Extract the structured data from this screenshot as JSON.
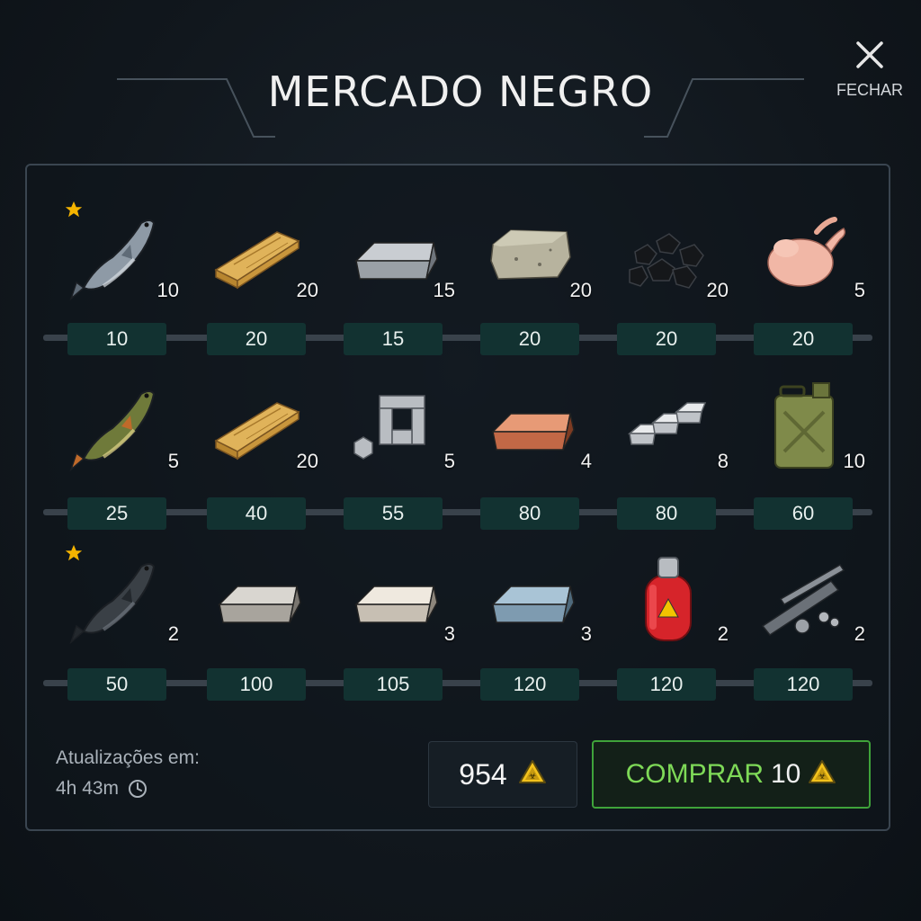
{
  "header": {
    "title": "MERCADO NEGRO",
    "close_label": "FECHAR"
  },
  "colors": {
    "accent_green": "#3fa33a",
    "price_bg": "#123231",
    "star": "#f5b400",
    "panel_border": "#3a4550"
  },
  "rows": [
    [
      {
        "icon": "salmon-fish-icon",
        "qty": "10",
        "price": "10",
        "starred": true
      },
      {
        "icon": "wood-plank-icon",
        "qty": "20",
        "price": "20",
        "starred": false
      },
      {
        "icon": "iron-ingot-icon",
        "qty": "15",
        "price": "15",
        "starred": false
      },
      {
        "icon": "stone-block-icon",
        "qty": "20",
        "price": "20",
        "starred": false
      },
      {
        "icon": "coal-icon",
        "qty": "20",
        "price": "20",
        "starred": false
      },
      {
        "icon": "raw-chicken-icon",
        "qty": "5",
        "price": "20",
        "starred": false
      }
    ],
    [
      {
        "icon": "pike-fish-icon",
        "qty": "5",
        "price": "25",
        "starred": false
      },
      {
        "icon": "wood-plank-icon",
        "qty": "20",
        "price": "40",
        "starred": false
      },
      {
        "icon": "metal-parts-icon",
        "qty": "5",
        "price": "55",
        "starred": false
      },
      {
        "icon": "copper-ingot-icon",
        "qty": "4",
        "price": "80",
        "starred": false
      },
      {
        "icon": "silver-bars-icon",
        "qty": "8",
        "price": "80",
        "starred": false
      },
      {
        "icon": "jerrycan-icon",
        "qty": "10",
        "price": "60",
        "starred": false
      }
    ],
    [
      {
        "icon": "sturgeon-fish-icon",
        "qty": "2",
        "price": "50",
        "starred": true
      },
      {
        "icon": "steel-ingot-icon",
        "qty": "",
        "price": "100",
        "starred": false
      },
      {
        "icon": "titanium-ingot-icon",
        "qty": "3",
        "price": "105",
        "starred": false
      },
      {
        "icon": "blue-steel-ingot-icon",
        "qty": "3",
        "price": "120",
        "starred": false
      },
      {
        "icon": "gas-cylinder-icon",
        "qty": "2",
        "price": "120",
        "starred": false
      },
      {
        "icon": "pipes-icon",
        "qty": "2",
        "price": "120",
        "starred": false
      }
    ]
  ],
  "footer": {
    "refresh_label": "Atualizações em:",
    "refresh_time": "4h 43m",
    "balance": "954",
    "currency_icon": "hazard-token-icon",
    "buy_label": "COMPRAR",
    "buy_count": "10"
  }
}
